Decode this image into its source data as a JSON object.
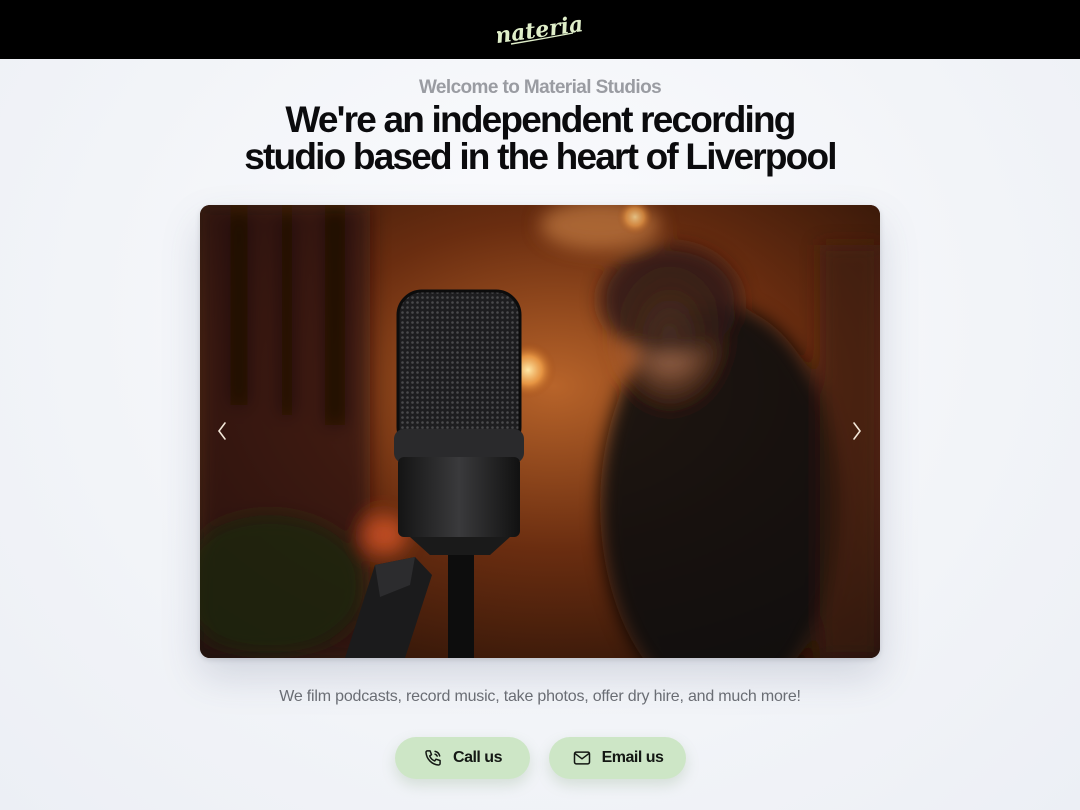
{
  "header": {
    "logo_text": "material",
    "logo_icon": "material-script-logo"
  },
  "hero": {
    "eyebrow": "Welcome to Material Studios",
    "headline_line1": "We're an independent recording",
    "headline_line2": "studio based in the heart of Liverpool",
    "tagline": "We film podcasts, record music, take photos, offer dry hire, and much more!"
  },
  "carousel": {
    "prev_icon": "chevron-left-icon",
    "next_icon": "chevron-right-icon"
  },
  "actions": {
    "call_label": "Call us",
    "call_icon": "phone-icon",
    "email_label": "Email us",
    "email_icon": "mail-icon"
  },
  "colors": {
    "topbar": "#000000",
    "logo": "#dfeec9",
    "button_bg": "#cde6c6",
    "headline": "#0b0b0d",
    "eyebrow": "#9a9ca2"
  }
}
